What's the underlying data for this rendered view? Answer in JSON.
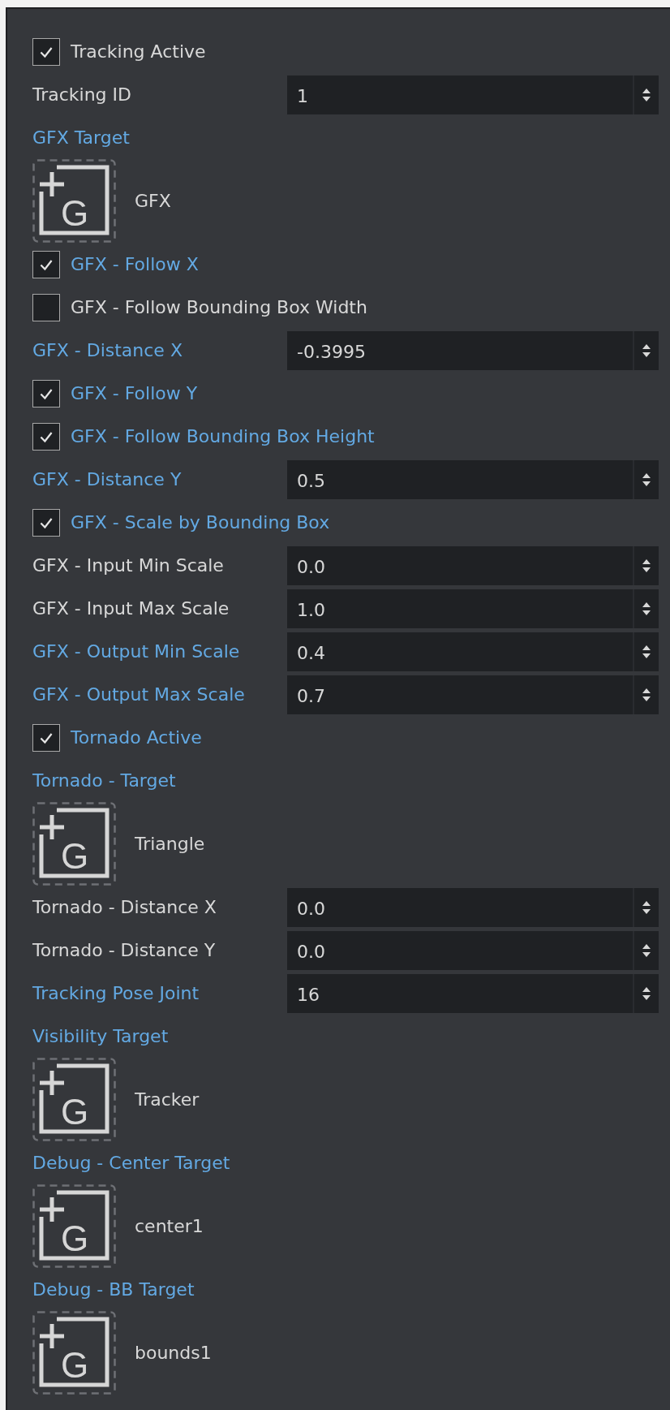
{
  "rows": [
    {
      "kind": "checkbox",
      "label": "Tracking Active",
      "checked": true,
      "modified": false
    },
    {
      "kind": "number",
      "label": "Tracking ID",
      "value": "1",
      "modified": false
    },
    {
      "kind": "target",
      "label": "GFX Target",
      "value": "GFX",
      "glyph": "G",
      "modified": true
    },
    {
      "kind": "checkbox",
      "label": "GFX - Follow X",
      "checked": true,
      "modified": true
    },
    {
      "kind": "checkbox",
      "label": "GFX - Follow Bounding Box Width",
      "checked": false,
      "modified": false
    },
    {
      "kind": "number",
      "label": "GFX - Distance X",
      "value": "-0.3995",
      "modified": true
    },
    {
      "kind": "checkbox",
      "label": "GFX - Follow Y",
      "checked": true,
      "modified": true
    },
    {
      "kind": "checkbox",
      "label": "GFX - Follow Bounding Box Height",
      "checked": true,
      "modified": true
    },
    {
      "kind": "number",
      "label": "GFX - Distance Y",
      "value": "0.5",
      "modified": true
    },
    {
      "kind": "checkbox",
      "label": "GFX - Scale by Bounding Box",
      "checked": true,
      "modified": true
    },
    {
      "kind": "number",
      "label": "GFX - Input Min Scale",
      "value": "0.0",
      "modified": false
    },
    {
      "kind": "number",
      "label": "GFX - Input Max Scale",
      "value": "1.0",
      "modified": false
    },
    {
      "kind": "number",
      "label": "GFX - Output Min Scale",
      "value": "0.4",
      "modified": true
    },
    {
      "kind": "number",
      "label": "GFX - Output Max Scale",
      "value": "0.7",
      "modified": true
    },
    {
      "kind": "checkbox",
      "label": "Tornado Active",
      "checked": true,
      "modified": true
    },
    {
      "kind": "target",
      "label": "Tornado - Target",
      "value": "Triangle",
      "glyph": "G",
      "modified": true
    },
    {
      "kind": "number",
      "label": "Tornado - Distance X",
      "value": "0.0",
      "modified": false
    },
    {
      "kind": "number",
      "label": "Tornado - Distance Y",
      "value": "0.0",
      "modified": false
    },
    {
      "kind": "number",
      "label": "Tracking Pose Joint",
      "value": "16",
      "modified": true
    },
    {
      "kind": "target",
      "label": "Visibility Target",
      "value": "Tracker",
      "glyph": "G",
      "modified": true
    },
    {
      "kind": "target",
      "label": "Debug - Center Target",
      "value": "center1",
      "glyph": "G",
      "modified": true
    },
    {
      "kind": "target",
      "label": "Debug - BB Target",
      "value": "bounds1",
      "glyph": "G",
      "modified": true
    }
  ]
}
